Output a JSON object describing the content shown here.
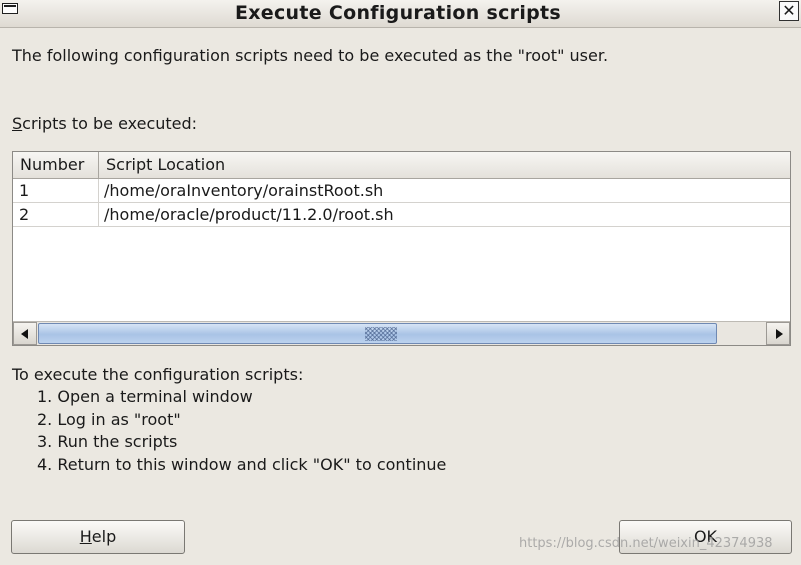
{
  "window": {
    "title": "Execute Configuration scripts",
    "close_glyph": "✕",
    "menu_icon": "window-menu-icon"
  },
  "intro_text": "The following configuration scripts need to be executed as the \"root\" user.",
  "scripts_label": {
    "mnemonic": "S",
    "rest": "cripts to be executed:"
  },
  "table": {
    "columns": [
      "Number",
      "Script Location"
    ],
    "rows": [
      {
        "number": "1",
        "location": "/home/oraInventory/orainstRoot.sh"
      },
      {
        "number": "2",
        "location": "/home/oracle/product/11.2.0/root.sh"
      }
    ]
  },
  "instructions": {
    "heading": "To execute the configuration scripts:",
    "steps": [
      "1. Open a terminal window",
      "2. Log in as \"root\"",
      "3. Run the scripts",
      "4. Return to this window and click \"OK\" to continue"
    ]
  },
  "buttons": {
    "help": {
      "mnemonic": "H",
      "rest": "elp"
    },
    "ok": "OK"
  },
  "watermark": "https://blog.csdn.net/weixin_42374938",
  "colors": {
    "dialog_bg": "#ebe8e1",
    "scroll_thumb": "#a9c3e6",
    "table_bg": "#ffffff"
  }
}
